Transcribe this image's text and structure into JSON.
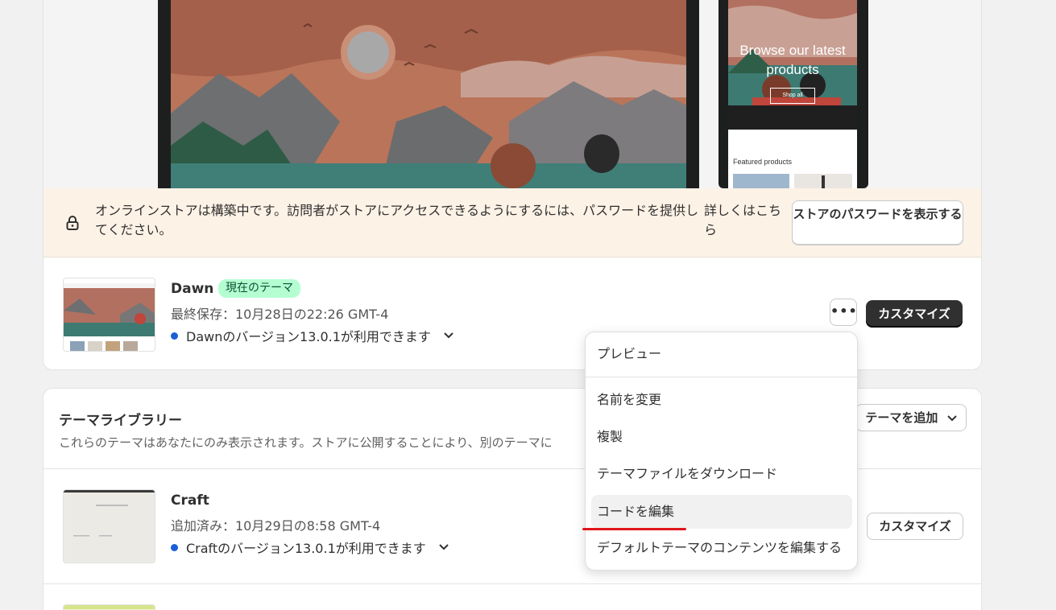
{
  "banner": {
    "text": "オンラインストアは構築中です。訪問者がストアにアクセスできるようにするには、パスワードを提供してください。",
    "link": "詳しくはこちら",
    "button": "ストアのパスワードを表示する"
  },
  "preview": {
    "mobile_hero": "Browse our latest products",
    "mobile_shop": "Shop all",
    "mobile_featured": "Featured products"
  },
  "current_theme": {
    "name": "Dawn",
    "badge": "現在のテーマ",
    "saved": "最終保存：10月28日の22:26 GMT-4",
    "version": "Dawnのバージョン13.0.1が利用できます",
    "more": "•••",
    "customize": "カスタマイズ"
  },
  "library": {
    "title": "テーマライブラリー",
    "description": "これらのテーマはあなたにのみ表示されます。ストアに公開することにより、別のテーマに",
    "add_button": "テーマを追加",
    "themes": [
      {
        "name": "Craft",
        "added": "追加済み：10月29日の8:58 GMT-4",
        "version": "Craftのバージョン13.0.1が利用できます",
        "customize": "カスタマイズ"
      }
    ]
  },
  "menu": {
    "items": [
      "プレビュー",
      "名前を変更",
      "複製",
      "テーマファイルをダウンロード",
      "コードを編集",
      "デフォルトテーマのコンテンツを編集する"
    ]
  },
  "colors": {
    "banner_bg": "#fdf2e6",
    "badge_bg": "#b4fed2",
    "primary_button": "#303030",
    "update_dot": "#1a5fd8",
    "annotation": "#e0161b"
  }
}
